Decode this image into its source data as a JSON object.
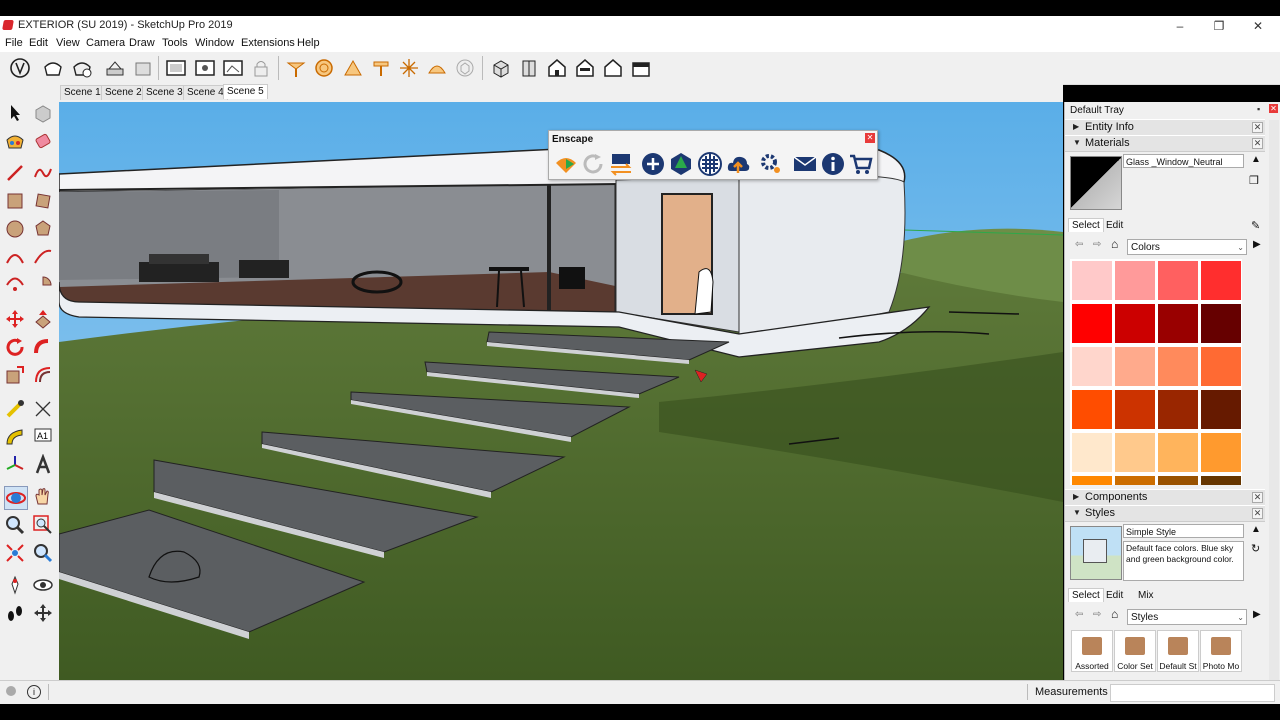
{
  "window": {
    "title": "EXTERIOR (SU 2019) - SketchUp Pro 2019",
    "controls": [
      "–",
      "❐",
      "✕"
    ]
  },
  "menu": [
    "File",
    "Edit",
    "View",
    "Camera",
    "Draw",
    "Tools",
    "Window",
    "Extensions",
    "Help"
  ],
  "scenes": {
    "tabs": [
      "Scene 1",
      "Scene 2",
      "Scene 3",
      "Scene 4",
      "Scene 5"
    ],
    "active": "Scene 5"
  },
  "enscape": {
    "title": "Enscape"
  },
  "tray": {
    "title": "Default Tray",
    "entity_info": "Entity Info",
    "materials": {
      "label": "Materials",
      "current_material": "Glass _Window_Neutral",
      "tab_select": "Select",
      "tab_edit": "Edit",
      "library": "Colors",
      "swatches": [
        "#ffc9c9",
        "#ff9a9a",
        "#ff6060",
        "#ff2e2e",
        "#ff0000",
        "#cc0000",
        "#990000",
        "#660000",
        "#ffd6cc",
        "#ffaa8c",
        "#ff8a5c",
        "#ff6a33",
        "#ff4d00",
        "#cc3300",
        "#992600",
        "#661a00",
        "#ffe8cc",
        "#ffc98c",
        "#ffb45c",
        "#ff9a2e",
        "#ff8800",
        "#cc6d00",
        "#995200",
        "#663600"
      ]
    },
    "components": "Components",
    "styles": {
      "label": "Styles",
      "name": "Simple Style",
      "description": "Default face colors. Blue sky and green background color.",
      "tab_select": "Select",
      "tab_edit": "Edit",
      "tab_mix": "Mix",
      "library": "Styles",
      "thumbs": [
        "Assorted",
        "Color Set",
        "Default St",
        "Photo Mo"
      ]
    }
  },
  "status": {
    "measurements_label": "Measurements",
    "measurements_value": ""
  },
  "colors": {
    "sky": "#66b3e8",
    "grass": "#4d6b2a",
    "accent_red": "#e83a3a"
  }
}
